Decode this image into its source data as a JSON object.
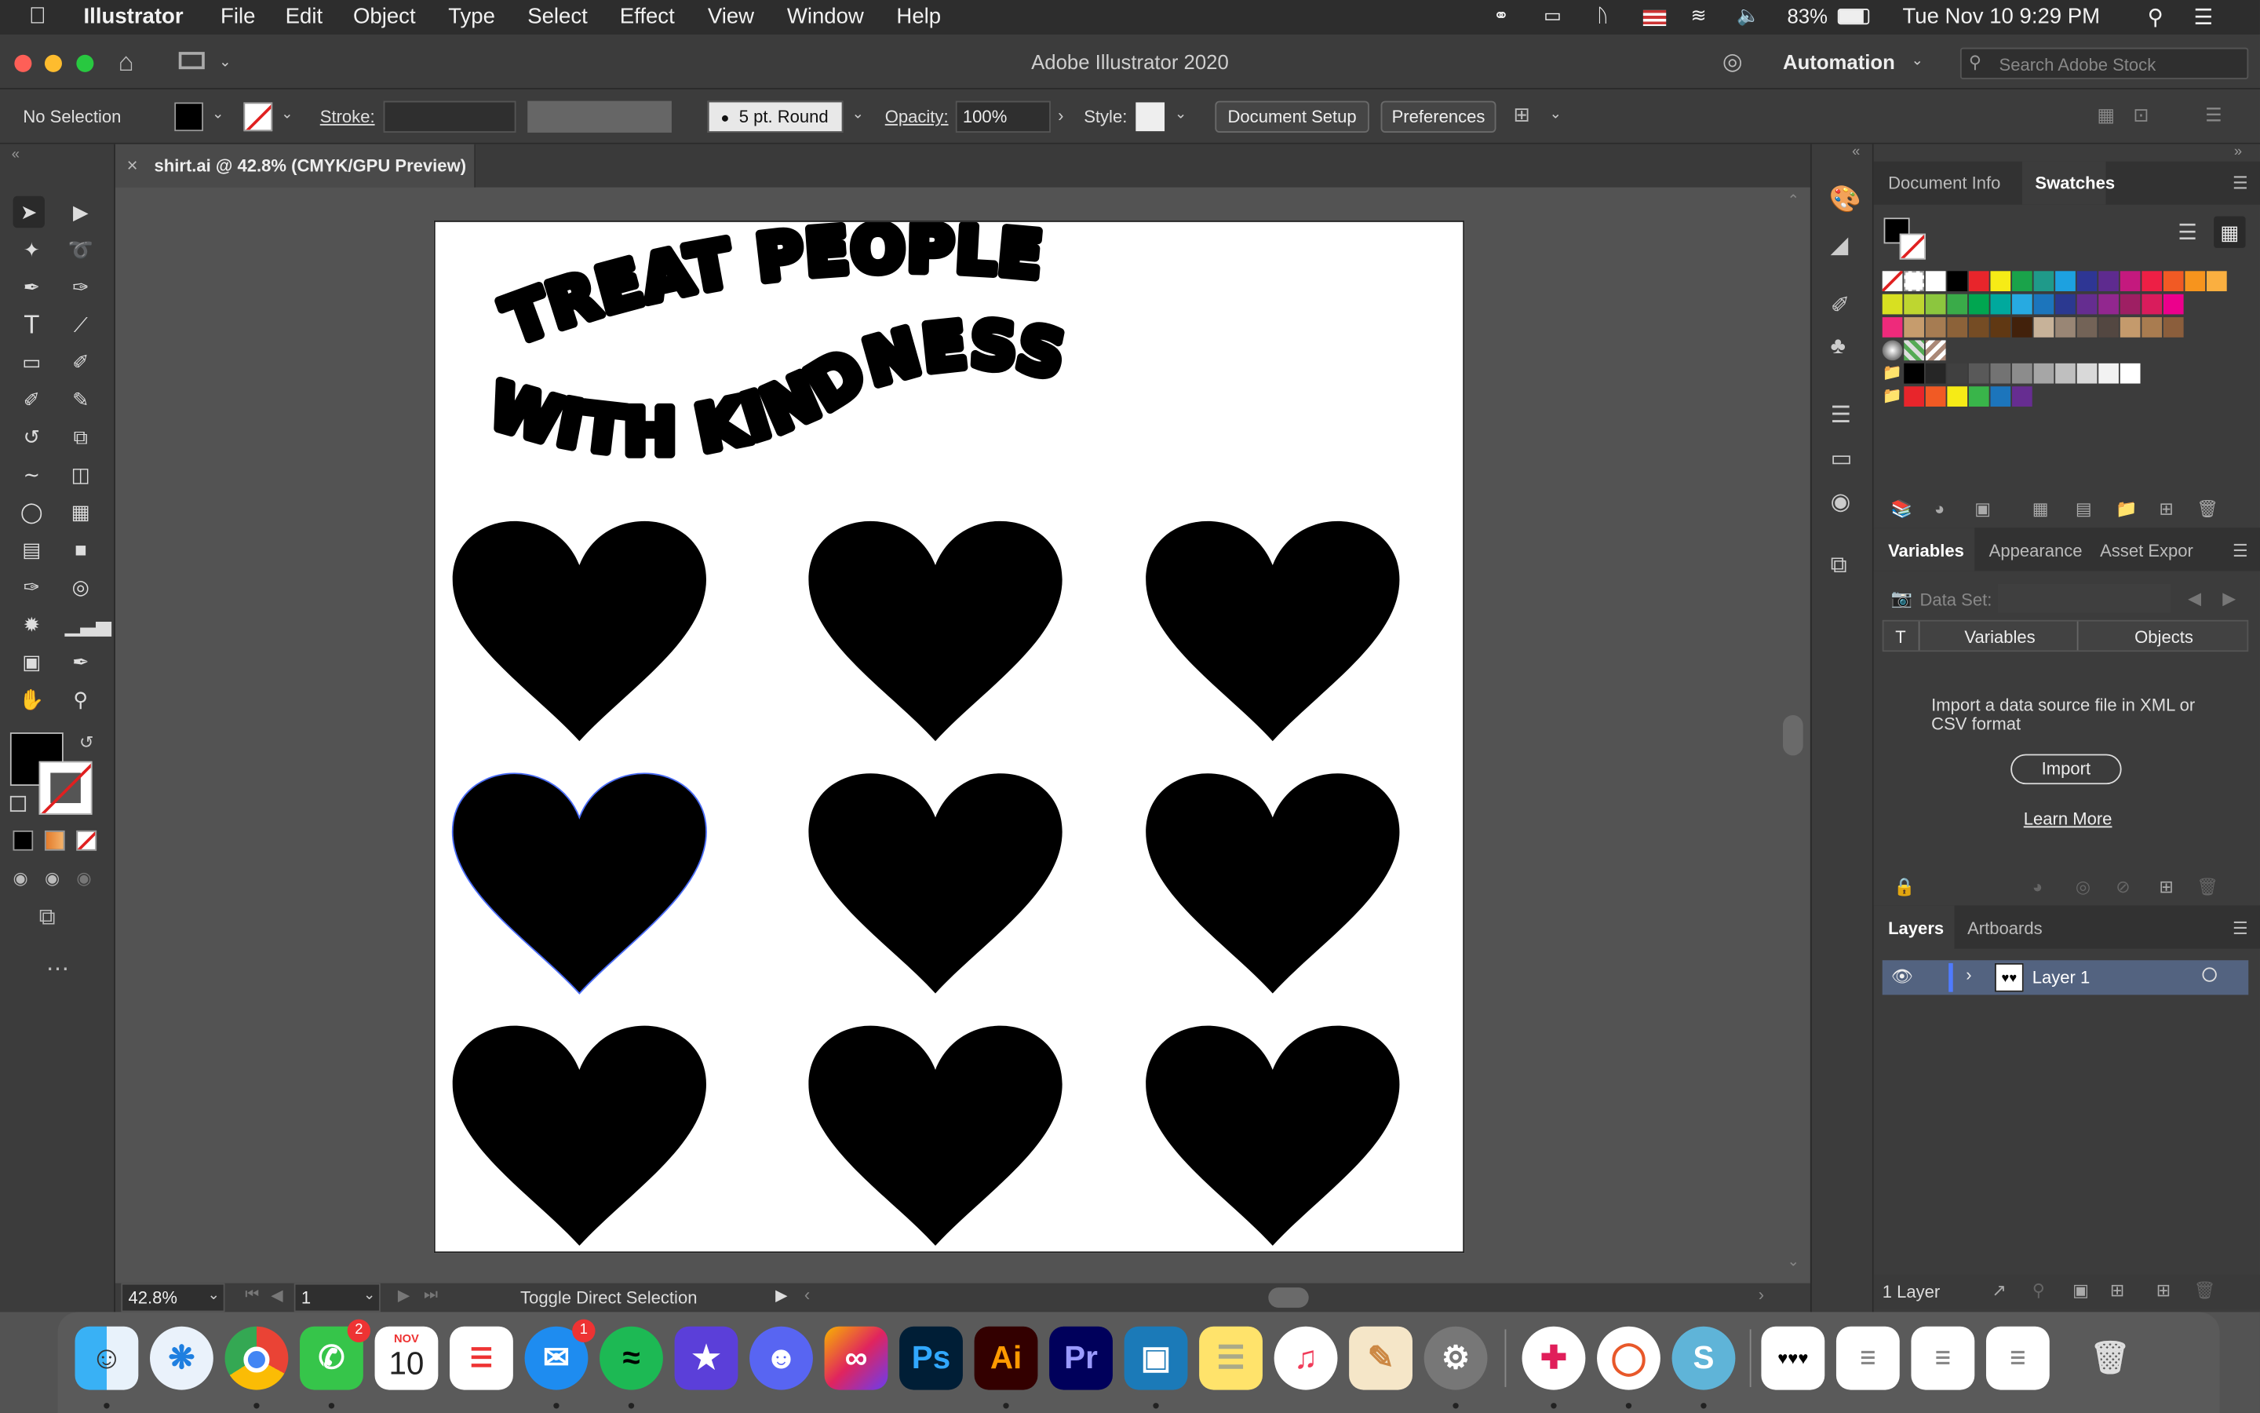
{
  "menubar": {
    "app_name": "Illustrator",
    "items": [
      "File",
      "Edit",
      "Object",
      "Type",
      "Select",
      "Effect",
      "View",
      "Window",
      "Help"
    ],
    "battery": "83%",
    "datetime": "Tue Nov 10  9:29 PM"
  },
  "titlebar": {
    "title": "Adobe Illustrator 2020",
    "workspace": "Automation",
    "search_placeholder": "Search Adobe Stock"
  },
  "control": {
    "selection": "No Selection",
    "stroke_label": "Stroke:",
    "brush": "5 pt. Round",
    "opacity_label": "Opacity:",
    "opacity_value": "100%",
    "style_label": "Style:",
    "document_setup": "Document Setup",
    "preferences": "Preferences"
  },
  "document": {
    "tab_title": "shirt.ai @ 42.8% (CMYK/GPU Preview)",
    "art_line1": "TREAT PEOPLE",
    "art_line2": "WITH KINDNESS",
    "heart_count": 9
  },
  "statusbar": {
    "zoom": "42.8%",
    "artboard": "1",
    "status": "Toggle Direct Selection"
  },
  "swatches_panel": {
    "tabs": [
      "Document Info",
      "Swatches"
    ],
    "active_tab": "Swatches",
    "row1": [
      "#ffffff",
      "#000000",
      "#e8252b",
      "#f6eb16",
      "#1aa34a",
      "#1f9a8a",
      "#1da1e0",
      "#2e3694",
      "#5e2b8f",
      "#c4197e",
      "#ed1f45",
      "#f15a24",
      "#f7941d",
      "#faaf40"
    ],
    "row2": [
      "#d8e021",
      "#bed630",
      "#8cc63e",
      "#3aab49",
      "#00a650",
      "#00a99d",
      "#27aae1",
      "#1c75bc",
      "#2b3990",
      "#652d90",
      "#92278f",
      "#9e1f63",
      "#d91c5c",
      "#ec008c"
    ],
    "row3": [
      "#ee2a7b",
      "#c69c6d",
      "#a67c52",
      "#8c6239",
      "#754c24",
      "#603813",
      "#42210b",
      "#c7b299",
      "#998675",
      "#736357",
      "#534741",
      "#c49a6c",
      "#a97c50",
      "#8b5e3c"
    ],
    "row5": [
      "#000000",
      "#262626",
      "#404040",
      "#595959",
      "#737373",
      "#8c8c8c",
      "#a6a6a6",
      "#bfbfbf",
      "#d9d9d9",
      "#f2f2f2",
      "#ffffff"
    ],
    "row6": [
      "#e8252b",
      "#f15a24",
      "#f6eb16",
      "#39b54a",
      "#1c75bc",
      "#662d91"
    ]
  },
  "variables_panel": {
    "tabs": [
      "Variables",
      "Appearance",
      "Asset Expor"
    ],
    "active_tab": "Variables",
    "dataset_label": "Data Set:",
    "col_type": "T",
    "col_variables": "Variables",
    "col_objects": "Objects",
    "message": "Import a data source file in XML or CSV format",
    "import": "Import",
    "learn_more": "Learn More"
  },
  "layers_panel": {
    "tabs": [
      "Layers",
      "Artboards"
    ],
    "active_tab": "Layers",
    "layer_name": "Layer 1",
    "count": "1 Layer"
  },
  "dock": {
    "messages_badge": "2",
    "discord_badge": "1",
    "calendar_month": "NOV",
    "calendar_day": "10",
    "ps": "Ps",
    "ai": "Ai",
    "pr": "Pr"
  }
}
